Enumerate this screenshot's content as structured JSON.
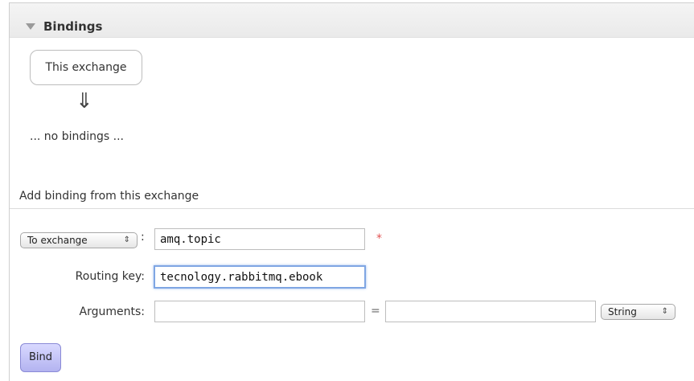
{
  "bindings": {
    "title": "Bindings",
    "exchange_box_label": "This exchange",
    "arrow_glyph": "⇓",
    "empty_text": "... no bindings ..."
  },
  "add_binding": {
    "heading": "Add binding from this exchange",
    "destination_type": {
      "selected": "To exchange",
      "arrows": "⇕"
    },
    "destination_colon": ":",
    "destination_value": "amq.topic",
    "required_mark": "*",
    "routing_key_label": "Routing key:",
    "routing_key_value": "tecnology.rabbitmq.ebook",
    "arguments_label": "Arguments:",
    "argument_key_value": "",
    "equals_sign": "=",
    "argument_value": "",
    "argument_type": {
      "selected": "String",
      "arrows": "⇕"
    },
    "bind_button_label": "Bind"
  },
  "colors": {
    "required": "#e25353",
    "focus": "#7fa6e3",
    "button": "#c4c4f6"
  }
}
